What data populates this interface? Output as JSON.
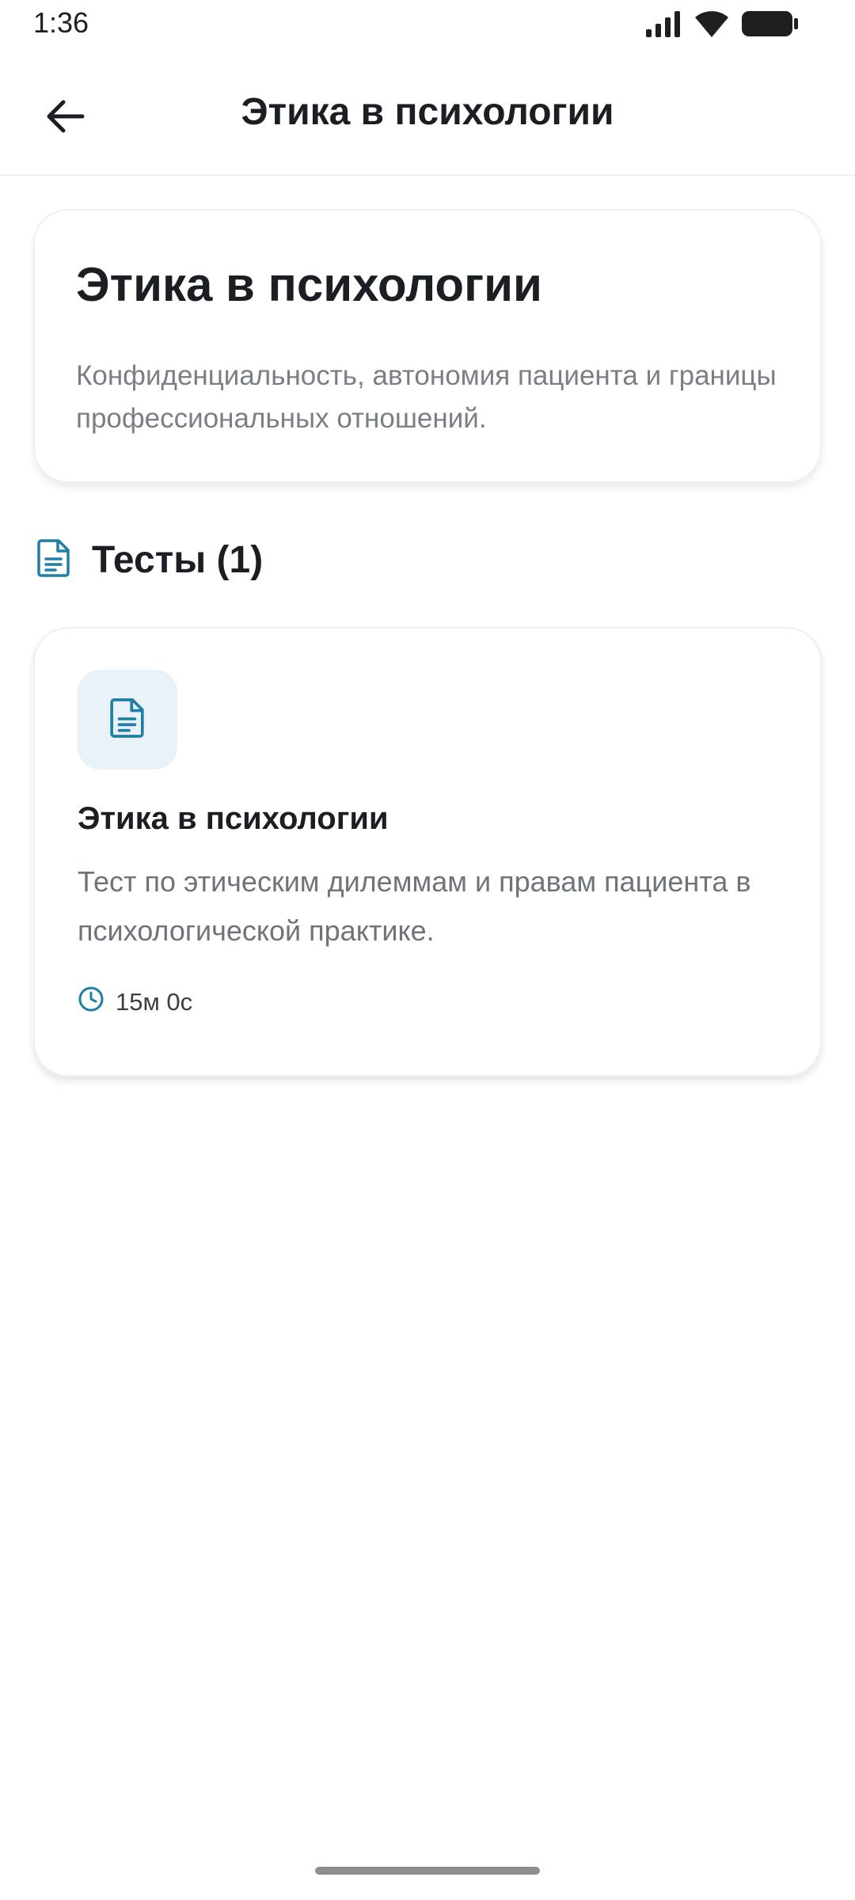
{
  "status_bar": {
    "time": "1:36",
    "icons": [
      "signal-icon",
      "wifi-icon",
      "battery-icon"
    ]
  },
  "app_bar": {
    "title": "Этика в психологии",
    "back_icon": "arrow-left-icon"
  },
  "topic": {
    "title": "Этика в психологии",
    "description": "Конфиденциальность, автономия пациента и границы профессиональных отношений."
  },
  "tests_section": {
    "title": "Тесты (1)",
    "icon": "document-icon",
    "items": [
      {
        "title": "Этика в психологии",
        "description": "Тест по этическим дилеммам и правам пациента в психологической практике.",
        "duration": "15м 0с",
        "icon": "document-icon",
        "duration_icon": "clock-icon"
      }
    ]
  },
  "colors": {
    "accent": "#1f7fa6",
    "icon_bg": "#e8f2f8",
    "text_primary": "#1b1f23",
    "text_secondary": "#7a7f86"
  }
}
